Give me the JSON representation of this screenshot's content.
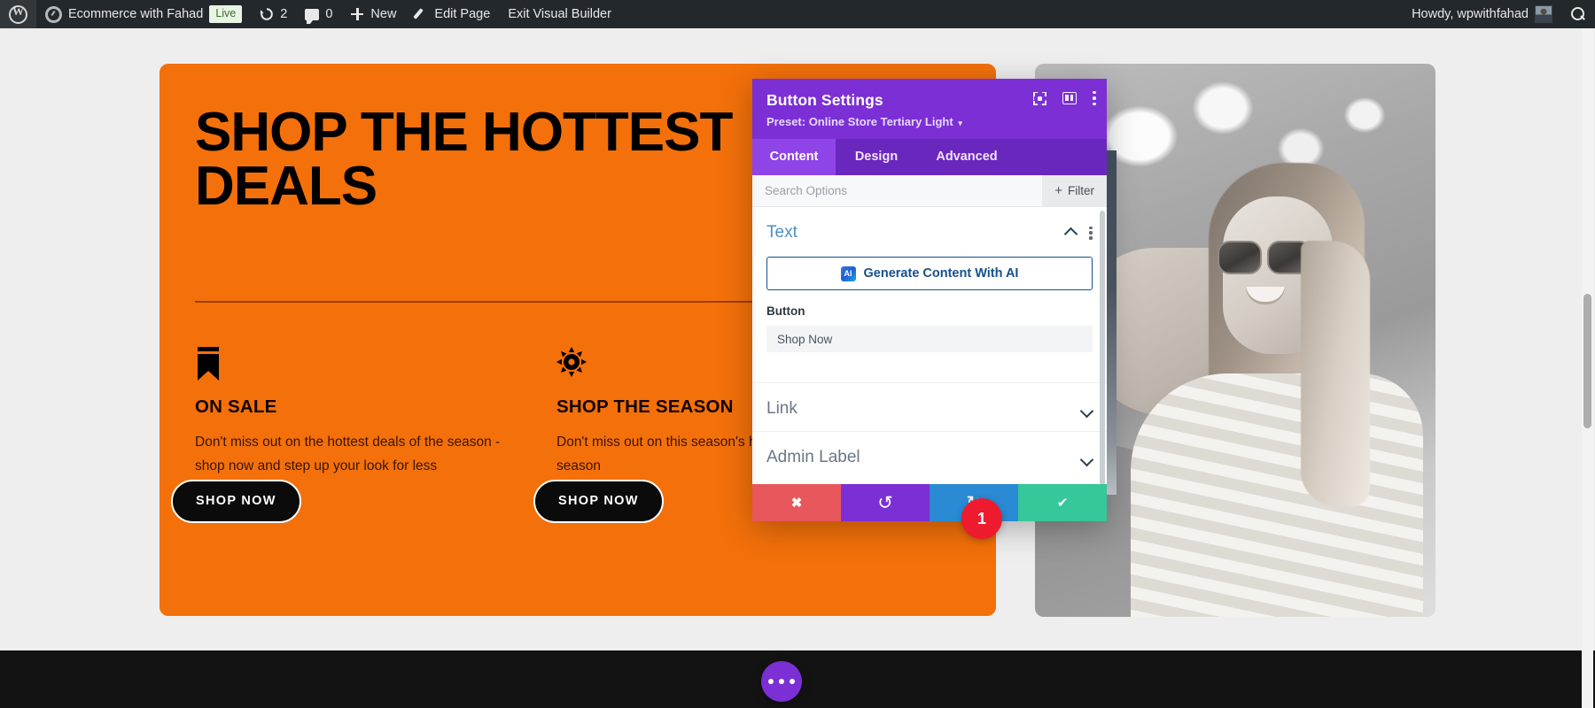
{
  "adminbar": {
    "items": [
      {
        "name": "wp-logo",
        "label": ""
      },
      {
        "name": "site-name",
        "label": "Ecommerce with Fahad"
      },
      {
        "name": "live-badge",
        "label": "Live"
      },
      {
        "name": "updates",
        "label": "2"
      },
      {
        "name": "comments",
        "label": "0"
      },
      {
        "name": "new",
        "label": "New"
      },
      {
        "name": "edit-page",
        "label": "Edit Page"
      },
      {
        "name": "exit-visual-builder",
        "label": "Exit Visual Builder"
      }
    ],
    "site_name": "Ecommerce with Fahad",
    "live_label": "Live",
    "updates_count": "2",
    "comments_count": "0",
    "new_label": "New",
    "edit_page_label": "Edit Page",
    "exit_builder_label": "Exit Visual Builder",
    "howdy": "Howdy, wpwithfahad"
  },
  "promo": {
    "headline": "SHOP THE HOTTEST\nDEALS",
    "columns": [
      {
        "icon": "bookmark-icon",
        "title": "ON SALE",
        "text": "Don't miss out on the hottest deals of the season - shop now and step up your look for less",
        "button": "SHOP NOW"
      },
      {
        "icon": "sun-icon",
        "title": "SHOP THE SEASON",
        "text": "Don't miss out on this season's hottest looks of the season",
        "button": "SHOP NOW"
      }
    ]
  },
  "modal": {
    "title": "Button Settings",
    "preset_label": "Preset: Online Store Tertiary Light",
    "preset_caret": "▾",
    "header_icons": [
      "focus-icon",
      "layout-icon",
      "kebab-menu-icon"
    ],
    "tabs": [
      {
        "label": "Content",
        "active": true
      },
      {
        "label": "Design",
        "active": false
      },
      {
        "label": "Advanced",
        "active": false
      }
    ],
    "search_placeholder": "Search Options",
    "search_value": "",
    "filter_label": "Filter",
    "filter_plus": "+",
    "sections": [
      {
        "name": "text",
        "label": "Text",
        "open": true
      },
      {
        "name": "link",
        "label": "Link",
        "open": false
      },
      {
        "name": "admin-label",
        "label": "Admin Label",
        "open": false
      }
    ],
    "ai_button": {
      "badge": "AI",
      "label": "Generate Content With AI"
    },
    "button_field": {
      "label": "Button",
      "value": "Shop Now",
      "placeholder": ""
    },
    "footer_buttons": [
      {
        "name": "cancel-button",
        "glyph": "✖"
      },
      {
        "name": "undo-button",
        "glyph": "↺"
      },
      {
        "name": "redo-button",
        "glyph": "↻"
      },
      {
        "name": "save-button",
        "glyph": "✔"
      }
    ],
    "count_badge": "1"
  },
  "fab": {
    "label": "•••"
  },
  "colors": {
    "divi_purple": "#7b2fd4",
    "tab_active": "#8f44e8",
    "promo_orange": "#f3700a",
    "badge_red": "#ee1b2e",
    "save_green": "#36c79a",
    "cancel_red": "#e8575c",
    "redo_blue": "#2a8ad4",
    "ai_blue": "#17508c",
    "adminbar_dark": "#23282d"
  }
}
